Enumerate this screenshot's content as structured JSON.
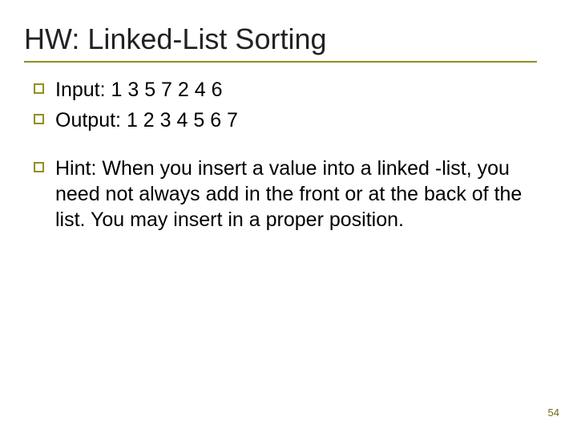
{
  "slide": {
    "title": "HW: Linked-List Sorting",
    "bullets": [
      {
        "text": "Input: 1 3 5 7 2 4 6"
      },
      {
        "text": "Output: 1 2 3 4 5 6 7"
      },
      {
        "text": "Hint: When you insert a value into a linked -list, you need not always add in the front or at the back of the list.  You may insert in a proper position."
      }
    ],
    "page_number": "54"
  }
}
